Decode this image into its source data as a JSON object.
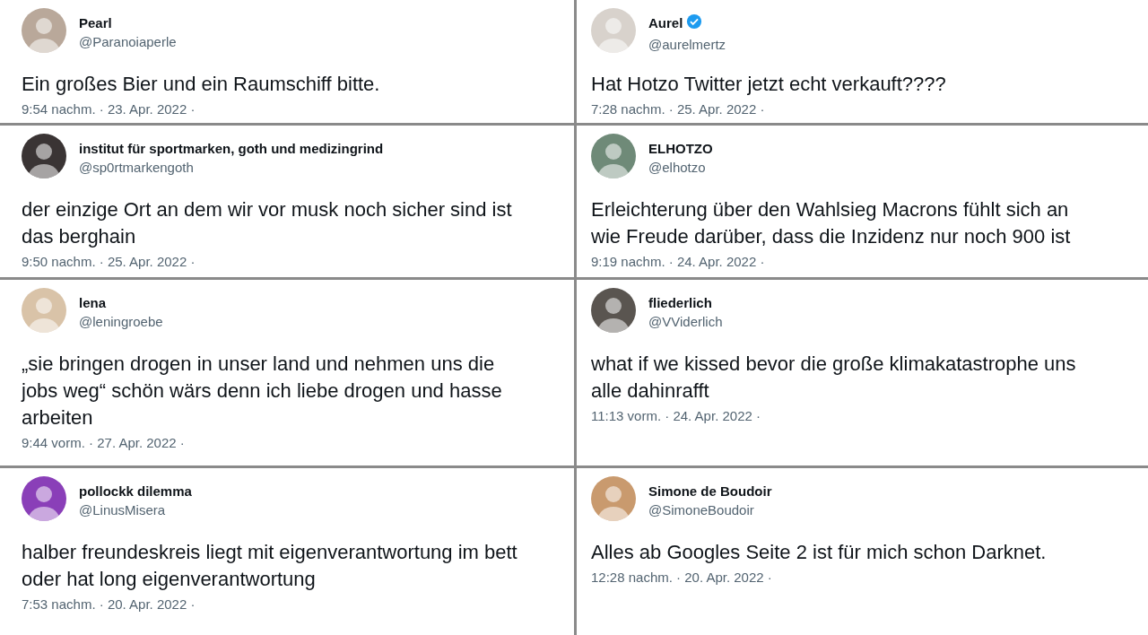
{
  "tweets": [
    {
      "name": "Pearl",
      "handle": "@Paranoiaperle",
      "verified": false,
      "text": "Ein großes Bier und ein Raumschiff bitte.",
      "time": "9:54 nachm. · 23. Apr. 2022 ·"
    },
    {
      "name": "Aurel",
      "handle": "@aurelmertz",
      "verified": true,
      "text": "Hat Hotzo Twitter jetzt echt verkauft????",
      "time": "7:28 nachm. · 25. Apr. 2022 ·"
    },
    {
      "name": "institut für sportmarken, goth und medizingrind",
      "handle": "@sp0rtmarkengoth",
      "verified": false,
      "text": "der einzige Ort an dem wir vor musk noch sicher sind ist das berghain",
      "time": "9:50 nachm. · 25. Apr. 2022 ·"
    },
    {
      "name": "ELHOTZO",
      "handle": "@elhotzo",
      "verified": false,
      "text": "Erleichterung über den Wahlsieg Macrons fühlt sich an wie Freude darüber, dass die Inzidenz nur noch 900 ist",
      "time": "9:19 nachm. · 24. Apr. 2022 ·"
    },
    {
      "name": "lena",
      "handle": "@leningroebe",
      "verified": false,
      "text": "„sie bringen drogen in unser land und nehmen uns die jobs weg“ schön wärs denn ich liebe drogen und hasse arbeiten",
      "time": "9:44 vorm. · 27. Apr. 2022 ·"
    },
    {
      "name": "fliederlich",
      "handle": "@VViderlich",
      "verified": false,
      "text": "what if we kissed bevor die große klimakatastrophe uns alle dahinrafft",
      "time": "11:13 vorm. · 24. Apr. 2022 ·"
    },
    {
      "name": "pollockk dilemma",
      "handle": "@LinusMisera",
      "verified": false,
      "text": "halber freundeskreis liegt mit eigenverantwortung im bett oder hat long eigenverantwortung",
      "time": "7:53 nachm. · 20. Apr. 2022 ·"
    },
    {
      "name": "Simone de Boudoir",
      "handle": "@SimoneBoudoir",
      "verified": false,
      "text": "Alles ab Googles Seite 2 ist für mich schon Darknet.",
      "time": "12:28 nachm. · 20. Apr. 2022 ·"
    }
  ]
}
